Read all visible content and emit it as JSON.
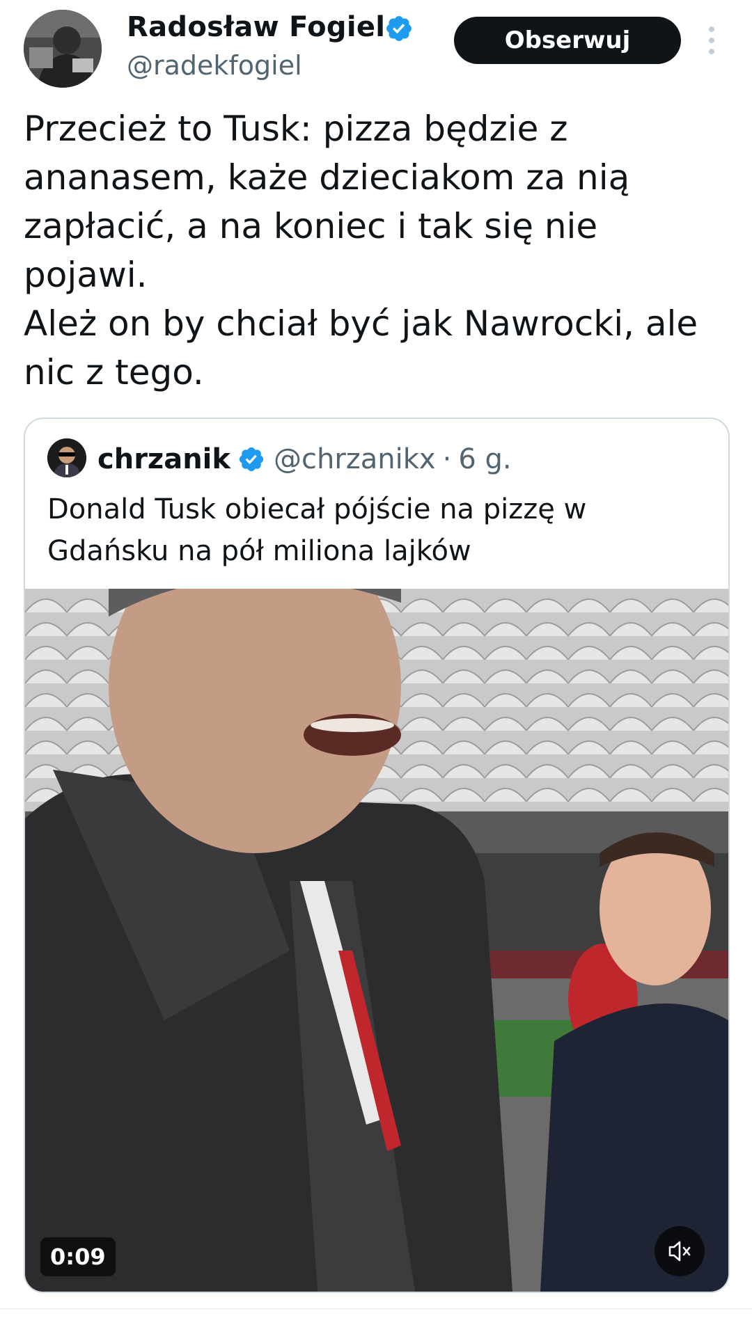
{
  "post": {
    "author_name": "Radosław Fogiel",
    "author_handle": "@radekfogiel",
    "follow_label": "Obserwuj",
    "text_lines": [
      "Przecież to Tusk: pizza będzie z",
      "ananasem, każe dzieciakom za nią",
      "zapłacić, a na koniec i tak się nie",
      "pojawi.",
      "Ależ on by chciał być jak Nawrocki, ale",
      "nic z tego."
    ]
  },
  "quote": {
    "author_name": "chrzanik",
    "author_handle": "@chrzanikx",
    "separator": "·",
    "time": "6 g.",
    "text_lines": [
      "Donald Tusk obiecał pójście na pizzę w",
      "Gdańsku na pół miliona lajków"
    ],
    "video": {
      "duration": "0:09",
      "muted": true
    }
  },
  "icons": {
    "verified": "verified-badge-icon",
    "more": "more-vertical-icon",
    "mute": "volume-muted-icon"
  },
  "colors": {
    "verified": "#1d9bf0",
    "text": "#0f1419",
    "secondary": "#536471",
    "border": "#cfd9de",
    "follow_bg": "#0f1419"
  }
}
